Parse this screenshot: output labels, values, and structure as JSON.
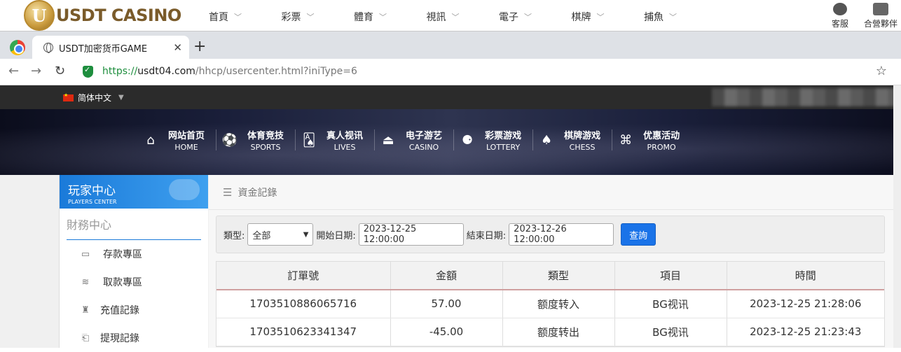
{
  "site_top": {
    "logo_text": "USDT CASINO",
    "nav": [
      "首頁",
      "彩票",
      "體育",
      "視訊",
      "電子",
      "棋牌",
      "捕魚"
    ],
    "right": [
      "客服",
      "合營夥伴"
    ]
  },
  "browser": {
    "tab_title": "USDT加密货币GAME",
    "url_scheme": "https://",
    "url_host": "usdt04.com",
    "url_path": "/hhcp/usercenter.html?iniType=6"
  },
  "dark_strip": {
    "language": "简体中文"
  },
  "main_nav": [
    {
      "cn": "网站首页",
      "en": "HOME",
      "icon": "home-icon"
    },
    {
      "cn": "体育竞技",
      "en": "SPORTS",
      "icon": "ball-icon"
    },
    {
      "cn": "真人视讯",
      "en": "LIVES",
      "icon": "cards-icon"
    },
    {
      "cn": "电子游艺",
      "en": "CASINO",
      "icon": "slot-icon"
    },
    {
      "cn": "彩票游戏",
      "en": "LOTTERY",
      "icon": "lottery-icon"
    },
    {
      "cn": "棋牌游戏",
      "en": "CHESS",
      "icon": "spade-icon"
    },
    {
      "cn": "优惠活动",
      "en": "PROMO",
      "icon": "gift-icon"
    }
  ],
  "sidebar": {
    "title_cn": "玩家中心",
    "title_en": "PLAYERS CENTER",
    "section": "財務中心",
    "items": [
      "存款專區",
      "取款專區",
      "充值記錄",
      "提現記錄"
    ]
  },
  "main": {
    "breadcrumb": "資金記錄",
    "filter": {
      "type_label": "類型:",
      "type_value": "全部",
      "start_label": "開始日期:",
      "start_value": "2023-12-25 12:00:00",
      "end_label": "結束日期:",
      "end_value": "2023-12-26 12:00:00",
      "query_button": "查詢"
    },
    "table": {
      "headers": [
        "訂單號",
        "金額",
        "類型",
        "項目",
        "時間"
      ],
      "rows": [
        [
          "1703510886065716",
          "57.00",
          "额度转入",
          "BG视讯",
          "2023-12-25 21:28:06"
        ],
        [
          "1703510623341347",
          "-45.00",
          "额度转出",
          "BG视讯",
          "2023-12-25 21:23:43"
        ]
      ]
    }
  }
}
